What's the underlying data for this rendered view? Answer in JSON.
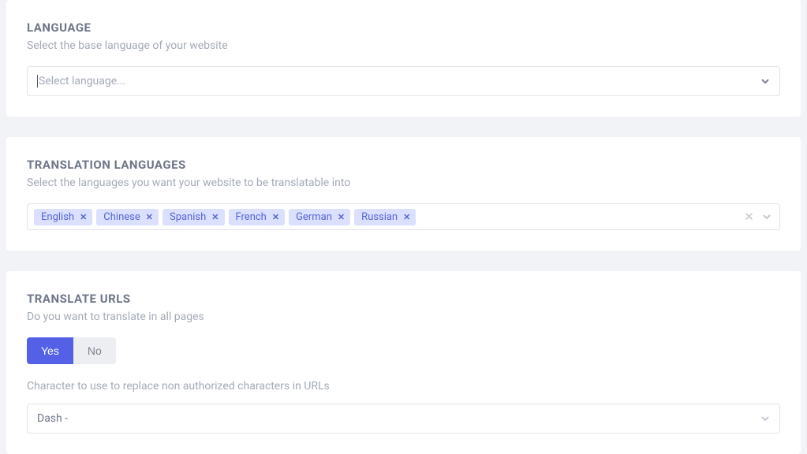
{
  "language": {
    "title": "LANGUAGE",
    "subtitle": "Select the base language of your website",
    "placeholder": "Select language..."
  },
  "translation": {
    "title": "TRANSLATION LANGUAGES",
    "subtitle": "Select the languages you want your website to be translatable into",
    "chips": [
      "English",
      "Chinese",
      "Spanish",
      "French",
      "German",
      "Russian"
    ]
  },
  "urls": {
    "title": "TRANSLATE URLS",
    "subtitle": "Do you want to translate in all pages",
    "yes": "Yes",
    "no": "No",
    "char_label": "Character to use to replace non authorized characters in URLs",
    "char_value": "Dash -"
  }
}
